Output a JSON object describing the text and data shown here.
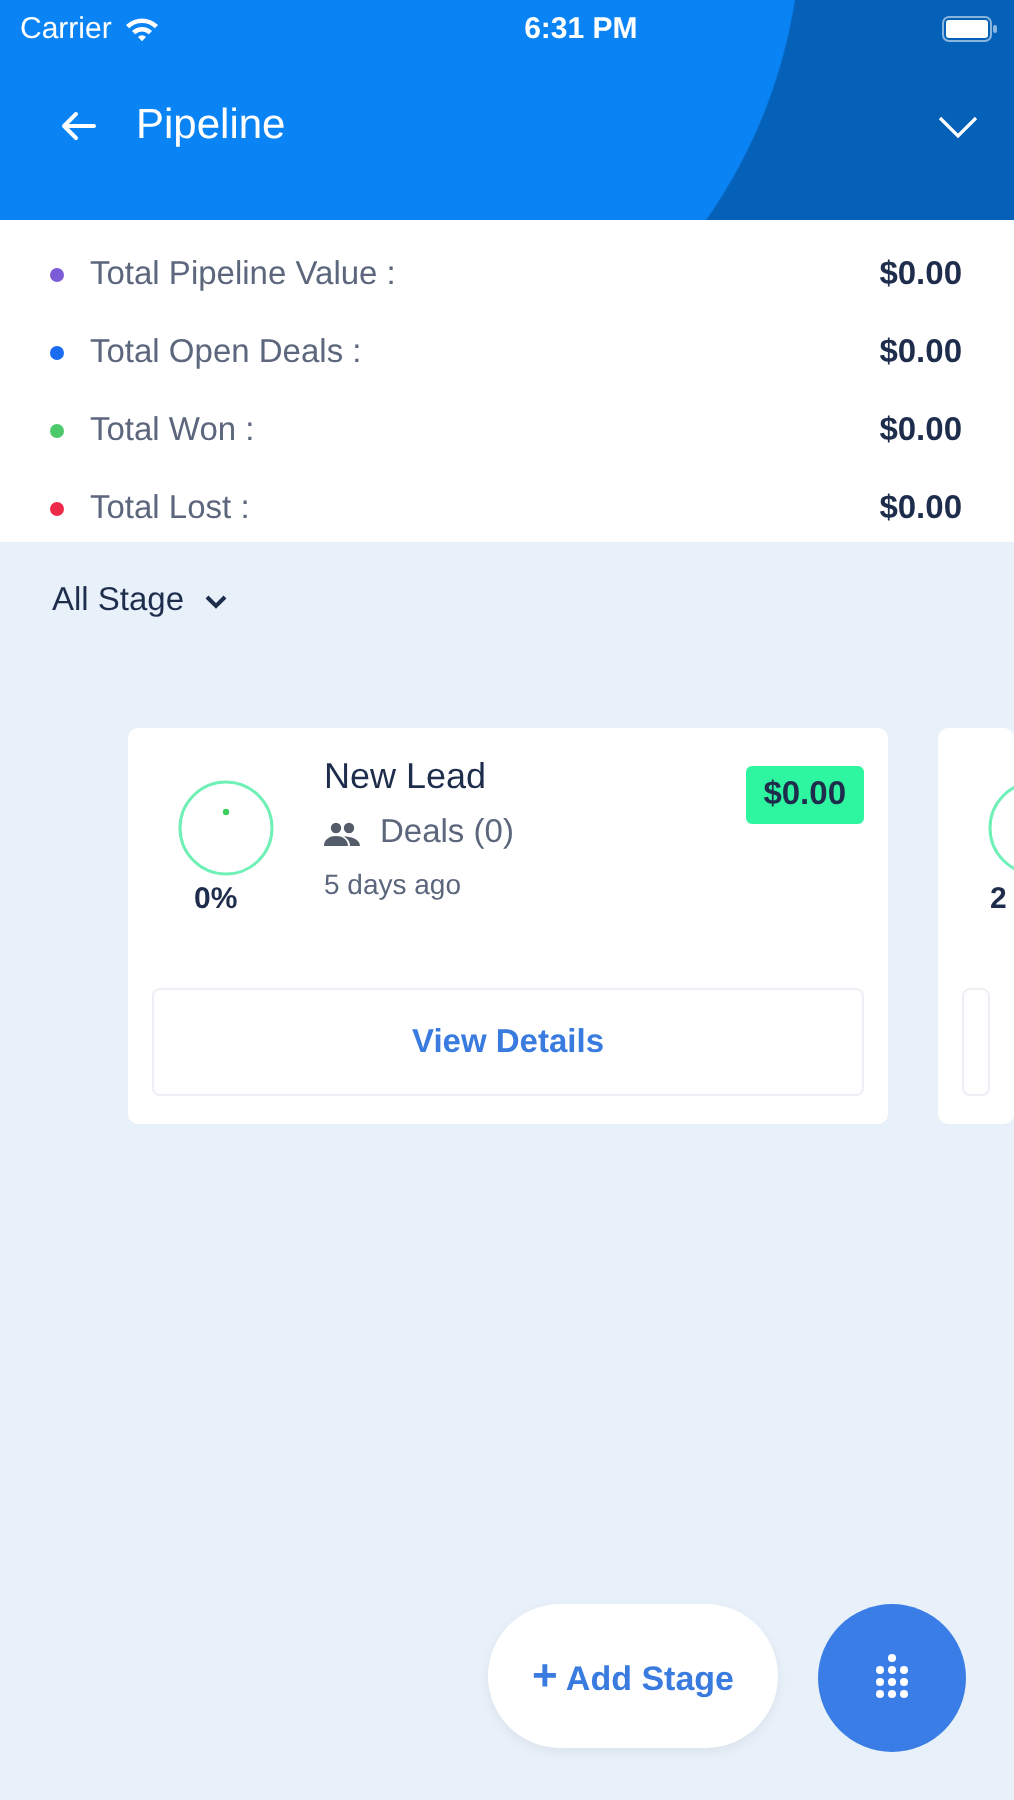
{
  "status_bar": {
    "carrier": "Carrier",
    "time": "6:31 PM"
  },
  "header": {
    "title": "Pipeline"
  },
  "summary": [
    {
      "label": "Total Pipeline Value :",
      "value": "$0.00",
      "color": "#7b5cd6"
    },
    {
      "label": "Total Open Deals :",
      "value": "$0.00",
      "color": "#1a6cf0"
    },
    {
      "label": "Total Won :",
      "value": "$0.00",
      "color": "#4cc96a"
    },
    {
      "label": "Total Lost :",
      "value": "$0.00",
      "color": "#ee2a4a"
    }
  ],
  "filter": {
    "label": "All Stage"
  },
  "stages": [
    {
      "name": "New Lead",
      "deals": "Deals (0)",
      "time": "5 days ago",
      "amount": "$0.00",
      "percent": "0%",
      "button": "View Details"
    },
    {
      "percent": "2"
    }
  ],
  "add_stage": {
    "icon": "+",
    "label": "Add Stage"
  }
}
